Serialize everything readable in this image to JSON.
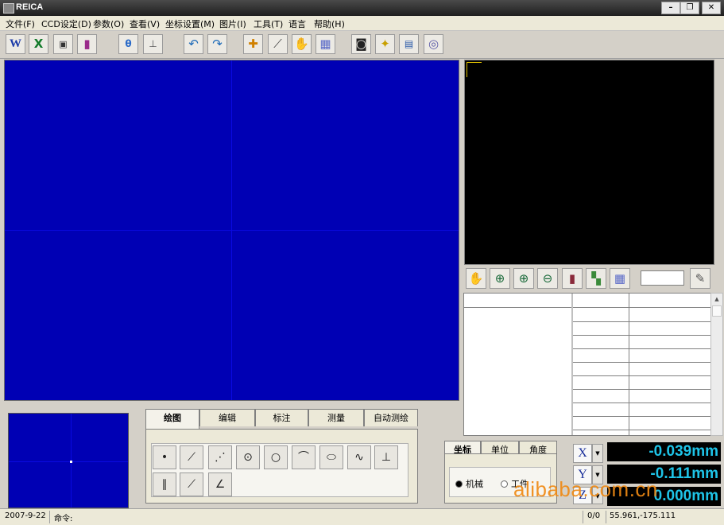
{
  "window": {
    "title": "REICA"
  },
  "menu": [
    "文件(F)",
    "CCD设定(D)",
    "参数(O)",
    "查看(V)",
    "坐标设置(M)",
    "图片(I)",
    "工具(T)",
    "语言",
    "帮助(H)"
  ],
  "drawing_tabs": [
    "绘图",
    "编辑",
    "标注",
    "测量",
    "自动测绘"
  ],
  "coord_tabs": [
    "坐标",
    "单位",
    "角度"
  ],
  "coord_mode": {
    "option1": "机械",
    "option2": "工件",
    "selected": "机械"
  },
  "readouts": {
    "x": {
      "axis": "X",
      "value": "-0.039mm"
    },
    "y": {
      "axis": "Y",
      "value": "-0.111mm"
    },
    "z": {
      "axis": "Z",
      "value": "0.000mm"
    }
  },
  "statusbar": {
    "date": "2007-9-22",
    "command_label": "命令:",
    "counter": "0/0",
    "cursor_coords": "55.961,-175.111"
  },
  "watermark": "alibaba.com.cn",
  "colors": {
    "canvas": "#0000b4",
    "readout_text": "#1ec4e8",
    "watermark": "#f08a14"
  }
}
